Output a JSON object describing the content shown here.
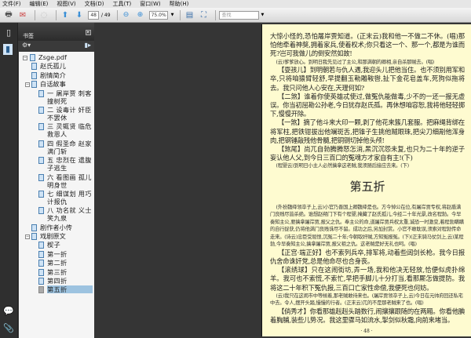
{
  "menu": [
    "文件(F)",
    "编辑(E)",
    "视图(V)",
    "文档(D)",
    "工具(T)",
    "窗口(W)",
    "帮助(H)"
  ],
  "toolbar": {
    "page_current": "48",
    "page_total": "/ 49",
    "zoom": "75.0%",
    "search_placeholder": "查找"
  },
  "panel": {
    "title": "书签"
  },
  "bookmarks": [
    {
      "label": "Zsge.pdf",
      "level": 0,
      "expanded": true
    },
    {
      "label": "赵氏孤儿",
      "level": 1
    },
    {
      "label": "剧情简介",
      "level": 1
    },
    {
      "label": "白话故事",
      "level": 1,
      "expanded": true
    },
    {
      "label": "一 屠岸贾 刺客撞树死",
      "level": 2
    },
    {
      "label": "二 设毒计 奸臣不罢休",
      "level": 2
    },
    {
      "label": "三 灵辄贤 临危救恩人",
      "level": 2
    },
    {
      "label": "四 假圣命 赵家满门斩",
      "level": 2
    },
    {
      "label": "五 忠烈在 遗腹子逃生",
      "level": 2
    },
    {
      "label": "六 看图画 孤儿明身世",
      "level": 2
    },
    {
      "label": "七 细谋划 用巧计报仇",
      "level": 2
    },
    {
      "label": "八 功名就 义士笑九泉",
      "level": 2
    },
    {
      "label": "剧作者小传",
      "level": 1
    },
    {
      "label": "戏剧原文",
      "level": 1,
      "expanded": true
    },
    {
      "label": "楔子",
      "level": 2
    },
    {
      "label": "第一折",
      "level": 2
    },
    {
      "label": "第二折",
      "level": 2
    },
    {
      "label": "第三折",
      "level": 2
    },
    {
      "label": "第四折",
      "level": 2
    },
    {
      "label": "第五折",
      "level": 2,
      "selected": true
    }
  ],
  "document": {
    "blocks": [
      {
        "type": "p",
        "text": "大惊小怪的,恐怕屠岸贾知道。(正末云)我和他一不做二不休。(唱)那怕他牵着神獒,拥着家兵,使着权术;你只看这一个、那一个,都是为谁而死?岂可我做儿的倒安然如故!"
      },
      {
        "type": "s",
        "text": "(云)爹爹放心。到明日我先见过了主公,和那满朝的卿相,亲自杀那贼去。(唱)"
      },
      {
        "type": "p",
        "text": "【耍孩儿】到明朝若与仇人遇,我迎头儿把他当住。也不须别用军和卒,只将咱猿臂轻舒,早提翻玉勒雕鞍辔,扯下金花皂盖车,死狗似拖将去。我只问他人心安在,天理何如?"
      },
      {
        "type": "p",
        "text": "【二煞】谁着你使英雄忒使过,做冤仇能做毒,少不的一还一报无虚误。你当初屈勘公孙老,今日犹存赵氏孤。再休想咱容恕,我将他轻轻掷下,慢慢开除。"
      },
      {
        "type": "p",
        "text": "【一煞】摘了他斗来大印一颗,剥了他花来簇几套服。把麻绳背绑在将军柱,把铁钳拔出他斓斑舌,把锥子生挑他贼眼珠,把尖刀细剐他浑身肉,把钢锤敲残他骨髓,把铜铡切掉他头颅!"
      },
      {
        "type": "p",
        "text": "【煞尾】尚兀自勃腾腾怒怎消,黑沉沉怨未复,也只为二十年的逆子妄认他人父,到今日三百口的冤魂方才家自有主!(下)"
      },
      {
        "type": "s",
        "text": "(程婴云)到明日小主人必然擒拿这老贼,我须随后接应去来。(下)"
      },
      {
        "type": "h",
        "text": "第五折"
      },
      {
        "type": "s",
        "text": "(外扮魏绛领卒子上,云)小官乃晋国上卿魏绛是也。方今悼公在位,有屠岸贾专权,将赵盾满门良贱尽皆杀绝。谁想赵朔门下有个程婴,掩藏了赵氏孤儿,今经二十年光景,改名程勃。今早奏知主公,要擒拿屠岸贾,报父之仇。奉主公的命,道屠岸贾兵权太重,诚恐一时激变,着程勃瞒瞒的自行捉获,仍将他满门良贱诛尽不留。成功之后,另加封赏。小官不敢耽误,须索对程勃传命走来。(诗云)忠臣受屈恨,沉冤二十年;今朝取奸贼,方知冤报冤。(下)(正末骑马仗剑上,云)某程勃,今早奏知主公,擒拿屠岸贾,报父祖之仇。这老贼是好无礼也呵。(唱)"
      },
      {
        "type": "p",
        "text": "【正宫·端正好】也不索列兵卒,排军将,动着些阔剑长枪。我今日报仇舍命诛奸党,总是他命尽也合身丧。"
      },
      {
        "type": "p",
        "text": "【滚绣球】只在这闹街坊,弄一场,我和他决无轻放,恰便似虎扑绵羊。我可也不索慌,不索忙,早把手脚儿十分打当,看那厮怎做提防。我将这二十年积下冤仇报,三百口亡家性命偿,我便死也何妨。"
      },
      {
        "type": "s",
        "text": "(云)我只在这闹市中等候着,那老贼敢待来也。(屠岸贾领卒子上,云)今日在元帅府回还私宅中去。令人,摆开头踏,慢慢的行者。(正末云)兀的不是那老贼来了也。(唱)"
      },
      {
        "type": "p",
        "text": "【倘秀才】你看那雄赳赳头踏数行,闹攘攘跟随的在两厢。你看他腆着胸脯,装些儿势况。我这里骤马如流水,掣剑似秋霜,向前来堵当。"
      }
    ],
    "page_label": "· 48 ·"
  }
}
